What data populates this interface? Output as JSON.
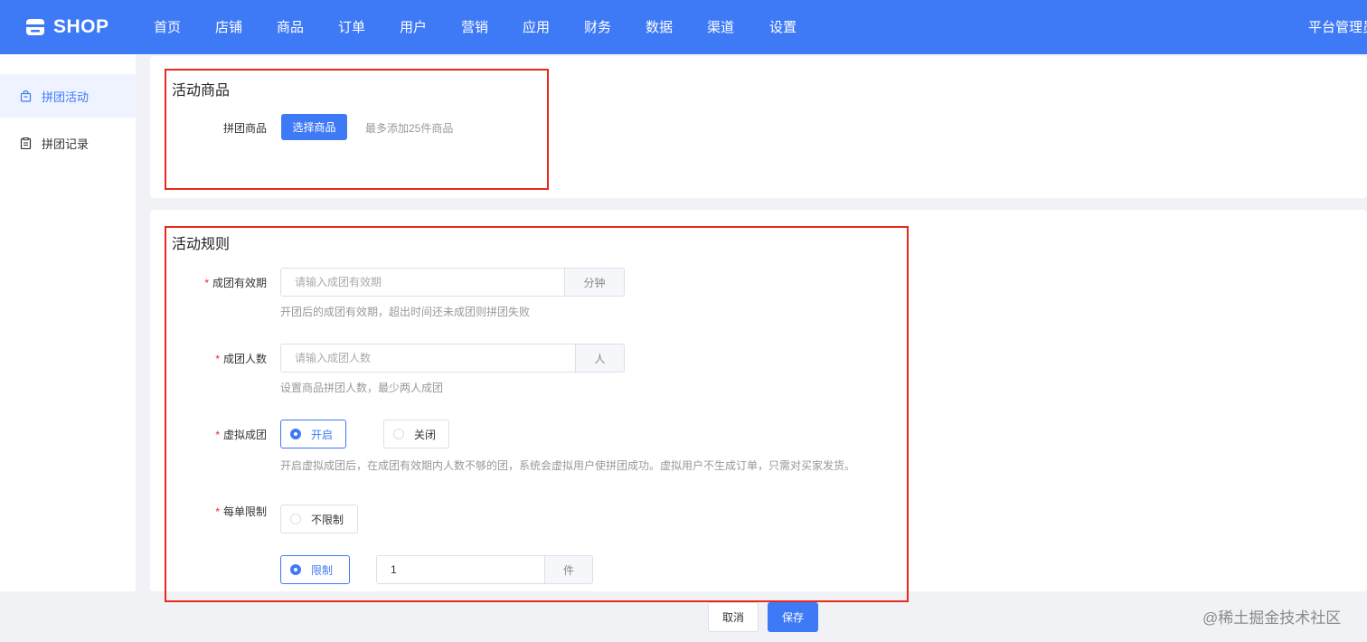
{
  "header": {
    "logo_text": "SHOP",
    "nav": [
      "首页",
      "店铺",
      "商品",
      "订单",
      "用户",
      "营销",
      "应用",
      "财务",
      "数据",
      "渠道",
      "设置"
    ],
    "user": "平台管理员"
  },
  "sidebar": {
    "items": [
      {
        "label": "拼团活动",
        "icon": "shop-bag-icon",
        "active": true
      },
      {
        "label": "拼团记录",
        "icon": "clipboard-icon",
        "active": false
      }
    ]
  },
  "activity_goods": {
    "title": "活动商品",
    "goods_label": "拼团商品",
    "select_button": "选择商品",
    "hint": "最多添加25件商品"
  },
  "rules": {
    "title": "活动规则",
    "validity": {
      "required_mark": "*",
      "label": "成团有效期",
      "placeholder": "请输入成团有效期",
      "value": "",
      "unit": "分钟",
      "hint": "开团后的成团有效期，超出时间还未成团则拼团失败"
    },
    "group_size": {
      "required_mark": "*",
      "label": "成团人数",
      "placeholder": "请输入成团人数",
      "value": "",
      "unit": "人",
      "hint": "设置商品拼团人数，最少两人成团"
    },
    "virtual_group": {
      "required_mark": "*",
      "label": "虚拟成团",
      "options": [
        {
          "label": "开启",
          "checked": true
        },
        {
          "label": "关闭",
          "checked": false
        }
      ],
      "hint": "开启虚拟成团后，在成团有效期内人数不够的团，系统会虚拟用户使拼团成功。虚拟用户不生成订单，只需对买家发货。"
    },
    "order_limit": {
      "required_mark": "*",
      "label": "每单限制",
      "options": [
        {
          "label": "不限制",
          "checked": false
        },
        {
          "label": "限制",
          "checked": true
        }
      ],
      "limit_value": "1",
      "limit_unit": "件"
    }
  },
  "footer": {
    "cancel": "取消",
    "save": "保存"
  },
  "watermark": "@稀土掘金技术社区",
  "colors": {
    "primary": "#3f7af6",
    "highlight_box": "#e8291c",
    "required": "#f5222d"
  }
}
